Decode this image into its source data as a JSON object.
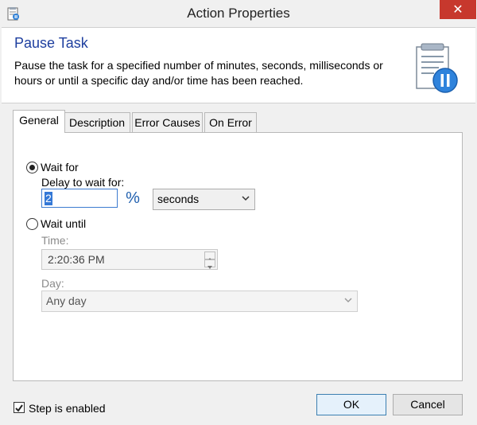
{
  "window": {
    "title": "Action Properties",
    "close_glyph": "✕"
  },
  "header": {
    "title": "Pause Task",
    "description": "Pause the task for a specified number of minutes, seconds, milliseconds or hours or until a specific day and/or time has been reached."
  },
  "tabs": [
    {
      "label": "General",
      "active": true
    },
    {
      "label": "Description",
      "active": false
    },
    {
      "label": "Error Causes",
      "active": false
    },
    {
      "label": "On Error",
      "active": false
    }
  ],
  "general": {
    "wait_for": {
      "label": "Wait for",
      "selected": true
    },
    "delay_label": "Delay to wait for:",
    "delay_value": "2",
    "percent_glyph": "%",
    "unit": {
      "selected": "seconds"
    },
    "wait_until": {
      "label": "Wait until",
      "selected": false
    },
    "time_label": "Time:",
    "time_value": "2:20:36 PM",
    "day_label": "Day:",
    "day_value": "Any day"
  },
  "footer": {
    "step_enabled_label": "Step is enabled",
    "step_enabled_checked": true,
    "ok_label": "OK",
    "cancel_label": "Cancel"
  },
  "colors": {
    "header_title": "#1e3f9f",
    "close_button": "#c7382d",
    "selection": "#3478d6"
  },
  "icons": [
    "app-icon",
    "pause-task-icon",
    "close-icon",
    "percent-icon",
    "chevron-down-icon",
    "spin-up-icon",
    "spin-down-icon",
    "checkmark-icon"
  ]
}
